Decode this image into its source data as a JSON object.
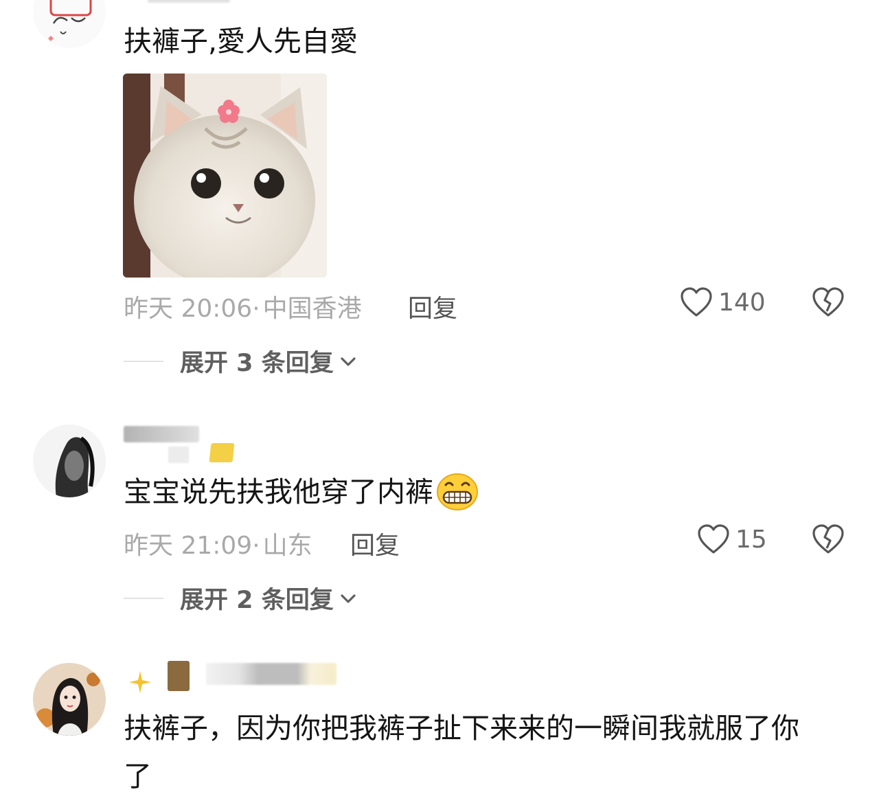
{
  "comments": [
    {
      "text": "扶褲子,愛人先自愛",
      "time": "昨天 20:06",
      "location": "中国香港",
      "reply_label": "回复",
      "likes": "140",
      "expand_label": "展开 3 条回复"
    },
    {
      "text": "宝宝说先扶我他穿了内裤",
      "time": "昨天 21:09",
      "location": "山东",
      "reply_label": "回复",
      "likes": "15",
      "expand_label": "展开 2 条回复"
    },
    {
      "text_line1": "扶裤子，因为你把我裤子扯下来来的一瞬间我就服了你",
      "text_line2": "了"
    }
  ],
  "separator": "·",
  "icons": {
    "like": "heart-outline-icon",
    "dislike": "broken-heart-icon",
    "expand": "chevron-down-icon",
    "emoji": "grinning-face-icon"
  },
  "colors": {
    "meta_gray": "#a9a9a9",
    "text": "#151515",
    "icon": "#555555"
  }
}
